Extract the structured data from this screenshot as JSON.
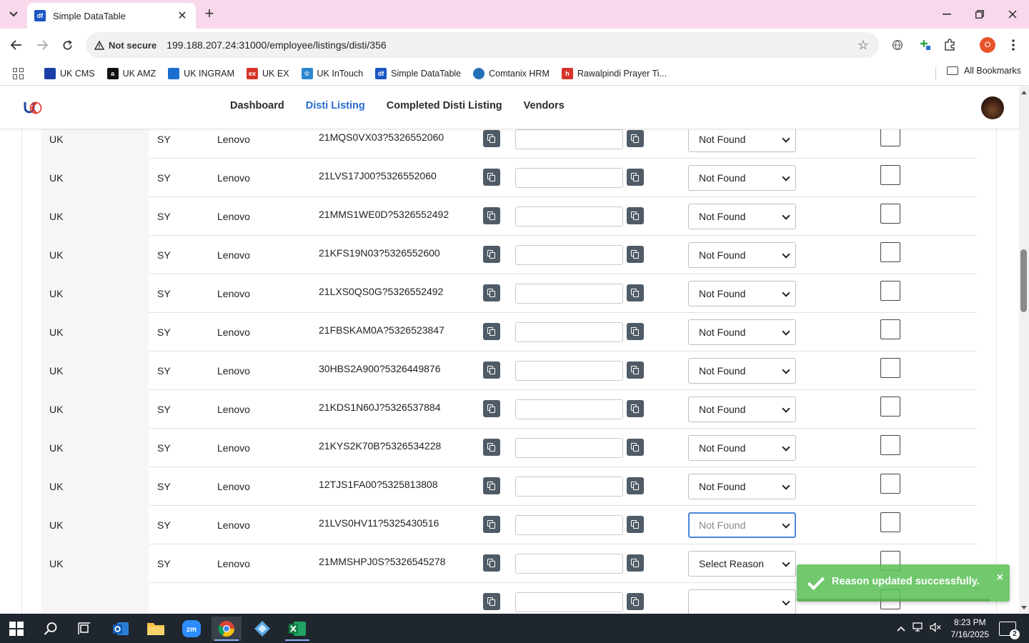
{
  "browser": {
    "tab_title": "Simple DataTable",
    "tab_favicon": "df",
    "not_secure_label": "Not secure",
    "url": "199.188.207.24:31000/employee/listings/disti/356",
    "profile_initial": "O",
    "bookmarks": [
      {
        "label": "UK CMS",
        "color": "#1a3fa8",
        "icon": ""
      },
      {
        "label": "UK AMZ",
        "color": "#111111",
        "icon": "a"
      },
      {
        "label": "UK INGRAM",
        "color": "#1b6fd1",
        "icon": ""
      },
      {
        "label": "UK EX",
        "color": "#d6342a",
        "icon": "ex"
      },
      {
        "label": "UK InTouch",
        "color": "#2a86d0",
        "icon": "©"
      },
      {
        "label": "Simple DataTable",
        "color": "#1a56c4",
        "icon": "df"
      },
      {
        "label": "Comtanix HRM",
        "color": "#2471b8",
        "icon": ""
      },
      {
        "label": "Rawalpindi Prayer Ti...",
        "color": "#d6342a",
        "icon": "h"
      }
    ],
    "all_bookmarks_label": "All Bookmarks"
  },
  "app": {
    "nav": [
      {
        "label": "Dashboard",
        "active": false
      },
      {
        "label": "Disti Listing",
        "active": true
      },
      {
        "label": "Completed Disti Listing",
        "active": false
      },
      {
        "label": "Vendors",
        "active": false
      }
    ],
    "accent_color": "#2a6cd4"
  },
  "table": {
    "rows": [
      {
        "region": "",
        "code": "",
        "brand": "",
        "sku": "",
        "reason": "",
        "focused": false
      },
      {
        "region": "UK",
        "code": "SY",
        "brand": "Lenovo",
        "sku": "21MQS0VX03?5326552060",
        "reason": "Not Found",
        "focused": false
      },
      {
        "region": "UK",
        "code": "SY",
        "brand": "Lenovo",
        "sku": "21LVS17J00?5326552060",
        "reason": "Not Found",
        "focused": false
      },
      {
        "region": "UK",
        "code": "SY",
        "brand": "Lenovo",
        "sku": "21MMS1WE0D?5326552492",
        "reason": "Not Found",
        "focused": false
      },
      {
        "region": "UK",
        "code": "SY",
        "brand": "Lenovo",
        "sku": "21KFS19N03?5326552600",
        "reason": "Not Found",
        "focused": false
      },
      {
        "region": "UK",
        "code": "SY",
        "brand": "Lenovo",
        "sku": "21LXS0QS0G?5326552492",
        "reason": "Not Found",
        "focused": false
      },
      {
        "region": "UK",
        "code": "SY",
        "brand": "Lenovo",
        "sku": "21FBSKAM0A?5326523847",
        "reason": "Not Found",
        "focused": false
      },
      {
        "region": "UK",
        "code": "SY",
        "brand": "Lenovo",
        "sku": "30HBS2A900?5326449876",
        "reason": "Not Found",
        "focused": false
      },
      {
        "region": "UK",
        "code": "SY",
        "brand": "Lenovo",
        "sku": "21KDS1N60J?5326537884",
        "reason": "Not Found",
        "focused": false
      },
      {
        "region": "UK",
        "code": "SY",
        "brand": "Lenovo",
        "sku": "21KYS2K70B?5326534228",
        "reason": "Not Found",
        "focused": false
      },
      {
        "region": "UK",
        "code": "SY",
        "brand": "Lenovo",
        "sku": "12TJS1FA00?5325813808",
        "reason": "Not Found",
        "focused": false
      },
      {
        "region": "UK",
        "code": "SY",
        "brand": "Lenovo",
        "sku": "21LVS0HV11?5325430516",
        "reason": "Not Found",
        "focused": true
      },
      {
        "region": "UK",
        "code": "SY",
        "brand": "Lenovo",
        "sku": "21MMSHPJ0S?5326545278",
        "reason": "Select Reason",
        "focused": false
      },
      {
        "region": "",
        "code": "",
        "brand": "",
        "sku": "",
        "reason": "",
        "focused": false
      }
    ]
  },
  "toast": {
    "message": "Reason updated successfully.",
    "close": "×",
    "color": "#5ec15a"
  },
  "taskbar": {
    "time": "8:23 PM",
    "date": "7/16/2025",
    "notifications": "2"
  }
}
